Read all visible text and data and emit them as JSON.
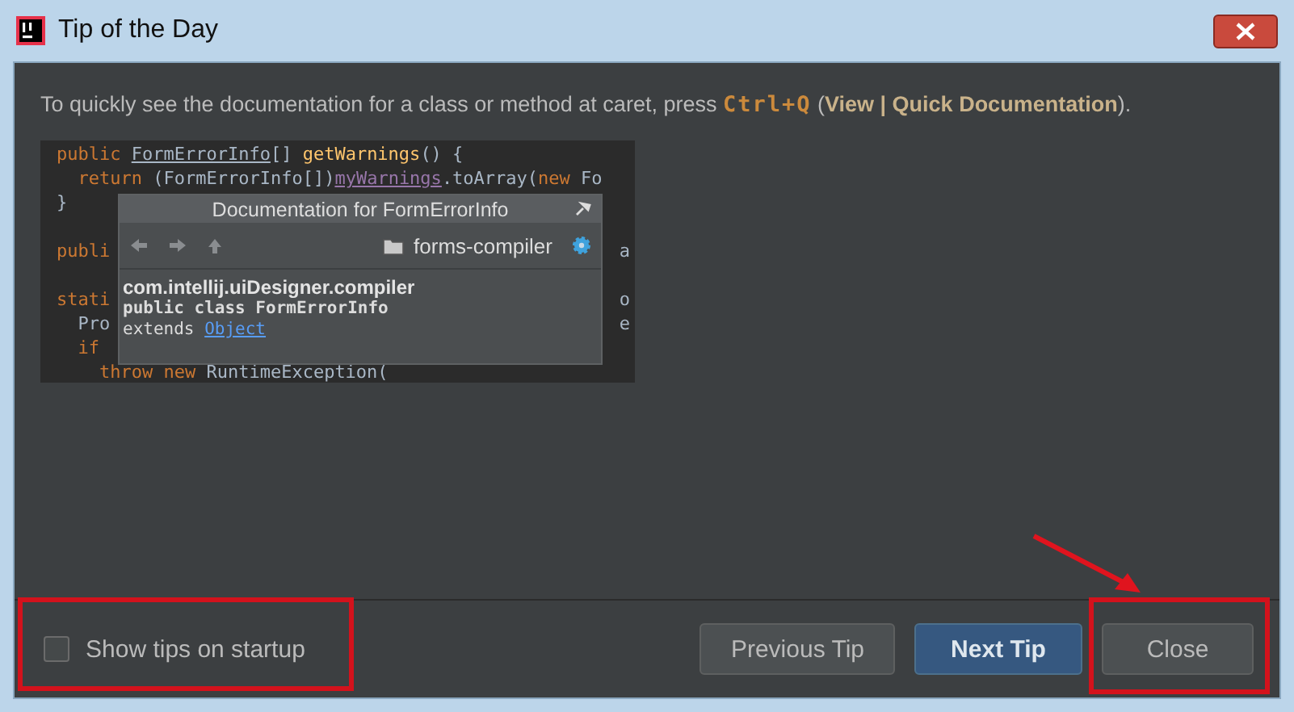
{
  "window": {
    "title": "Tip of the Day"
  },
  "tip": [
    {
      "kind": "plain",
      "text": "To quickly see the documentation for a class or method at caret, press "
    },
    {
      "kind": "shortcut",
      "text": "Ctrl+Q"
    },
    {
      "kind": "plain",
      "text": " ("
    },
    {
      "kind": "menu",
      "text": "View | Quick Documentation"
    },
    {
      "kind": "plain",
      "text": ")."
    }
  ],
  "code_lines": [
    {
      "kind": "code",
      "segments": [
        {
          "kind": "keyword",
          "text": "public "
        },
        {
          "kind": "type",
          "text": "FormErrorInfo"
        },
        {
          "kind": "plain",
          "text": "[] "
        },
        {
          "kind": "method",
          "text": "getWarnings"
        },
        {
          "kind": "plain",
          "text": "() {"
        }
      ]
    },
    {
      "kind": "code",
      "segments": [
        {
          "kind": "keyword",
          "text": "  return "
        },
        {
          "kind": "plain",
          "text": "(FormErrorInfo[])"
        },
        {
          "kind": "field",
          "text": "myWarnings"
        },
        {
          "kind": "plain",
          "text": ".toArray("
        },
        {
          "kind": "keyword",
          "text": "new "
        },
        {
          "kind": "plain",
          "text": "Fo"
        }
      ]
    },
    {
      "kind": "code",
      "segments": [
        {
          "kind": "plain",
          "text": "}"
        }
      ]
    },
    {
      "kind": "blank"
    },
    {
      "kind": "code",
      "segments": [
        {
          "kind": "keyword",
          "text": "publi"
        }
      ],
      "tail": "a"
    },
    {
      "kind": "blank"
    },
    {
      "kind": "code",
      "segments": [
        {
          "kind": "keyword",
          "text": "stati"
        }
      ],
      "tail": "o"
    },
    {
      "kind": "code",
      "segments": [
        {
          "kind": "plain",
          "text": "  Pro"
        }
      ],
      "tail": "e"
    },
    {
      "kind": "code",
      "segments": [
        {
          "kind": "keyword",
          "text": "  if"
        }
      ]
    },
    {
      "kind": "code",
      "segments": [
        {
          "kind": "keyword",
          "text": "    throw new "
        },
        {
          "kind": "plain",
          "text": "RuntimeException("
        }
      ]
    }
  ],
  "doc_popup": {
    "title": "Documentation for FormErrorInfo",
    "module": "forms-compiler",
    "package": "com.intellij.uiDesigner.compiler",
    "signature": "public class FormErrorInfo",
    "extends_label": "extends ",
    "extends_link": "Object"
  },
  "show_tips": {
    "label": "Show tips on startup",
    "checked": false
  },
  "buttons": [
    {
      "label": "Previous Tip",
      "kind": "normal"
    },
    {
      "label": "Next Tip",
      "kind": "primary"
    },
    {
      "label": "Close",
      "kind": "normal"
    }
  ]
}
